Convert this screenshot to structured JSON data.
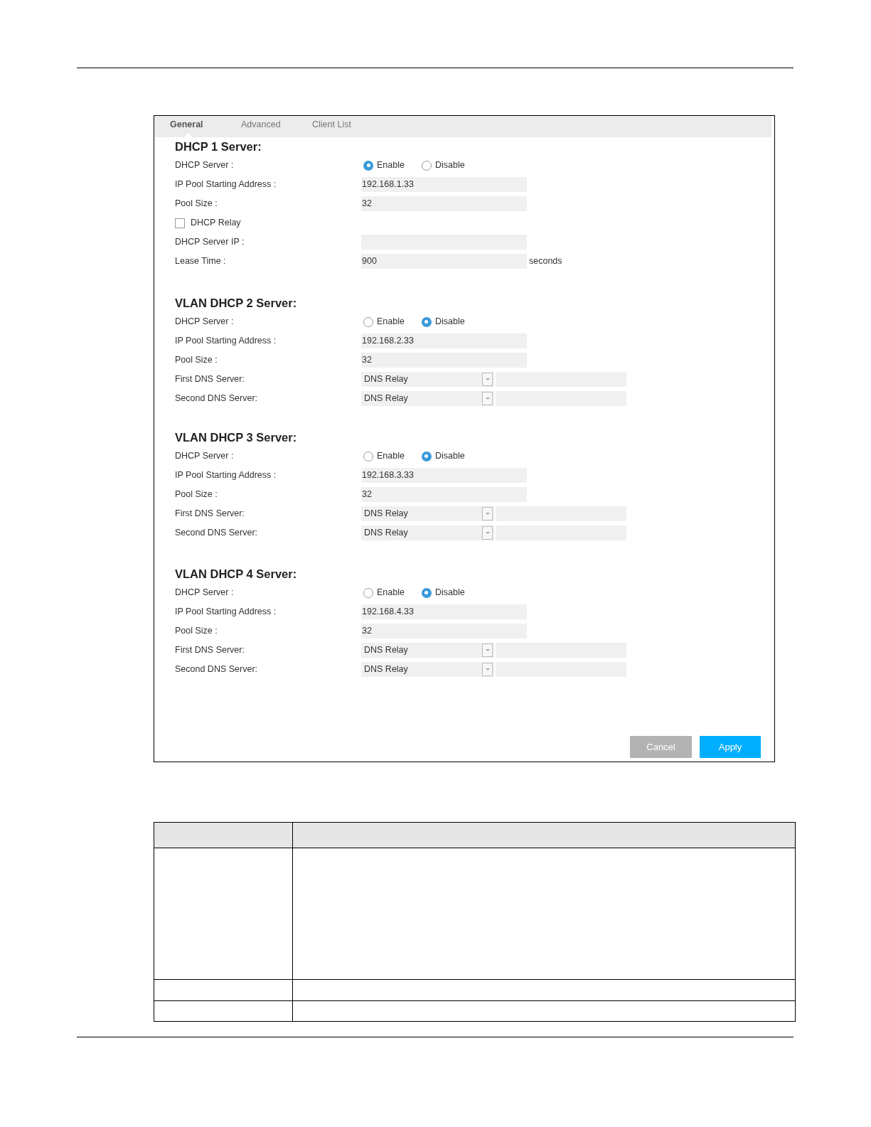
{
  "tabs": [
    {
      "label": "General",
      "selected": true
    },
    {
      "label": "Advanced",
      "selected": false
    },
    {
      "label": "Client List",
      "selected": false
    }
  ],
  "sections": [
    {
      "title": "DHCP 1 Server:",
      "rows": [
        {
          "kind": "radio",
          "label": "DHCP Server :",
          "options": [
            {
              "label": "Enable",
              "selected": true
            },
            {
              "label": "Disable",
              "selected": false
            }
          ]
        },
        {
          "kind": "field",
          "label": "IP Pool Starting Address :",
          "value": "192.168.1.33"
        },
        {
          "kind": "field",
          "label": "Pool Size :",
          "value": "32"
        },
        {
          "kind": "checkbox",
          "label": "DHCP Relay",
          "checked": false
        },
        {
          "kind": "field",
          "label": "DHCP Server IP :"
        },
        {
          "kind": "field",
          "label": "Lease Time :",
          "value": "900",
          "unit": "seconds"
        }
      ]
    },
    {
      "title": "VLAN DHCP 2 Server:",
      "rows": [
        {
          "kind": "radio",
          "label": "DHCP Server :",
          "options": [
            {
              "label": "Enable",
              "selected": false
            },
            {
              "label": "Disable",
              "selected": true
            }
          ]
        },
        {
          "kind": "field",
          "label": "IP Pool Starting Address :",
          "value": "192.168.2.33"
        },
        {
          "kind": "field",
          "label": "Pool Size :",
          "value": "32"
        },
        {
          "kind": "dns",
          "label": "First DNS Server:",
          "value": "DNS Relay"
        },
        {
          "kind": "dns",
          "label": "Second DNS Server:",
          "value": "DNS Relay"
        }
      ]
    },
    {
      "title": "VLAN DHCP 3 Server:",
      "rows": [
        {
          "kind": "radio",
          "label": "DHCP Server :",
          "options": [
            {
              "label": "Enable",
              "selected": false
            },
            {
              "label": "Disable",
              "selected": true
            }
          ]
        },
        {
          "kind": "field",
          "label": "IP Pool Starting Address :",
          "value": "192.168.3.33"
        },
        {
          "kind": "field",
          "label": "Pool Size :",
          "value": "32"
        },
        {
          "kind": "dns",
          "label": "First DNS Server:",
          "value": "DNS Relay"
        },
        {
          "kind": "dns",
          "label": "Second DNS Server:",
          "value": "DNS Relay"
        }
      ]
    },
    {
      "title": "VLAN DHCP 4 Server:",
      "rows": [
        {
          "kind": "radio",
          "label": "DHCP Server :",
          "options": [
            {
              "label": "Enable",
              "selected": false
            },
            {
              "label": "Disable",
              "selected": true
            }
          ]
        },
        {
          "kind": "field",
          "label": "IP Pool Starting Address :",
          "value": "192.168.4.33"
        },
        {
          "kind": "field",
          "label": "Pool Size :",
          "value": "32"
        },
        {
          "kind": "dns",
          "label": "First DNS Server:",
          "value": "DNS Relay"
        },
        {
          "kind": "dns",
          "label": "Second DNS Server:",
          "value": "DNS Relay"
        }
      ]
    }
  ],
  "buttons": [
    {
      "kind": "cancel",
      "label": "Cancel"
    },
    {
      "kind": "apply",
      "label": "Apply"
    }
  ]
}
